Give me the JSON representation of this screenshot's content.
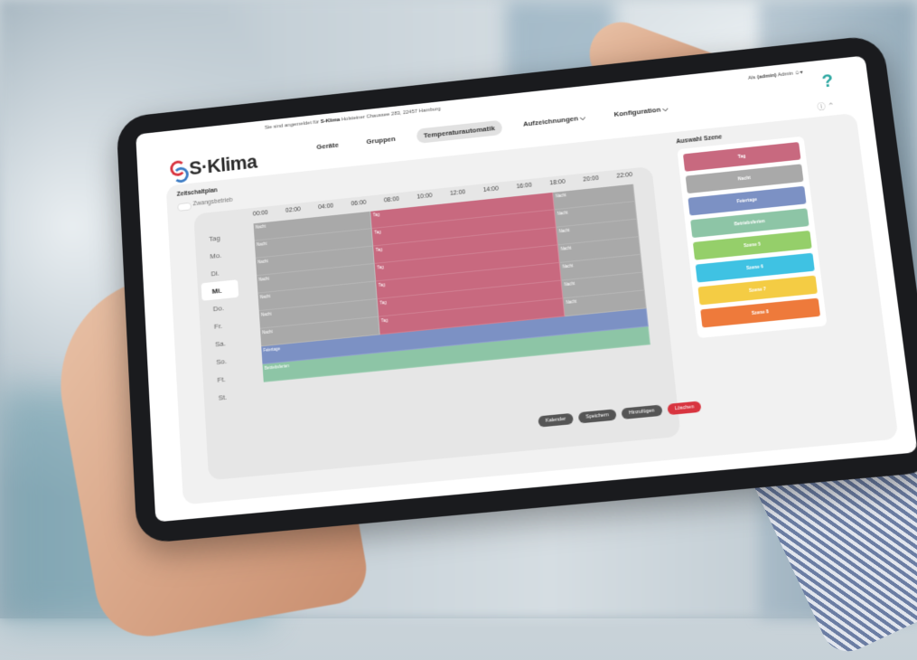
{
  "header": {
    "login_prefix": "Sie sind angemeldet für",
    "company": "S-Klima",
    "address": "Holsteiner Chaussee 283, 22457 Hamburg",
    "user_prefix": "Als",
    "user_name": "(admin)",
    "user_role": "Admin",
    "brand": "S·Klima",
    "help": "?"
  },
  "nav": {
    "items": [
      {
        "label": "Geräte"
      },
      {
        "label": "Gruppen"
      },
      {
        "label": "Temperaturautomatik"
      },
      {
        "label": "Aufzeichnungen ⌵"
      },
      {
        "label": "Konfiguration ⌵"
      }
    ],
    "active_index": 2
  },
  "schedule": {
    "title": "Zeitschaltplan",
    "toggle_label": "Zwangsbetrieb",
    "hours": [
      "00:00",
      "02:00",
      "04:00",
      "06:00",
      "08:00",
      "10:00",
      "12:00",
      "14:00",
      "16:00",
      "18:00",
      "20:00",
      "22:00"
    ],
    "days": [
      "Tag",
      "Mo.",
      "Di.",
      "Mi.",
      "Do.",
      "Fr.",
      "Sa.",
      "So.",
      "Ft.",
      "St."
    ],
    "selected_day": "Mi."
  },
  "scene_panel": {
    "title": "Auswahl Szene",
    "scenes": [
      {
        "label": "Tag",
        "color": "#c8697f"
      },
      {
        "label": "Nacht",
        "color": "#a9a9a9"
      },
      {
        "label": "Feiertage",
        "color": "#7c91c4"
      },
      {
        "label": "Betriebsferien",
        "color": "#8dc5a6"
      },
      {
        "label": "Szene 5",
        "color": "#95cf6a"
      },
      {
        "label": "Szene 6",
        "color": "#3fc2e3"
      },
      {
        "label": "Szene 7",
        "color": "#f4cc44"
      },
      {
        "label": "Szene 8",
        "color": "#ee7a3b"
      }
    ]
  },
  "actions": {
    "kalender": "Kalender",
    "speichern": "Speichern",
    "hinzufuegen": "Hinzufügen",
    "loeschen": "Löschen"
  },
  "block_labels": {
    "tag": "Tag",
    "nacht": "Nacht",
    "feiertage": "Feiertage",
    "betriebsferien": "Betriebsferien"
  },
  "colors": {
    "tag": "#c8697f",
    "nacht": "#a9a9a9",
    "feiertage": "#7c91c4",
    "betriebsferien": "#8dc5a6",
    "brand_red": "#d8343f",
    "brand_teal": "#2aa6a0"
  }
}
